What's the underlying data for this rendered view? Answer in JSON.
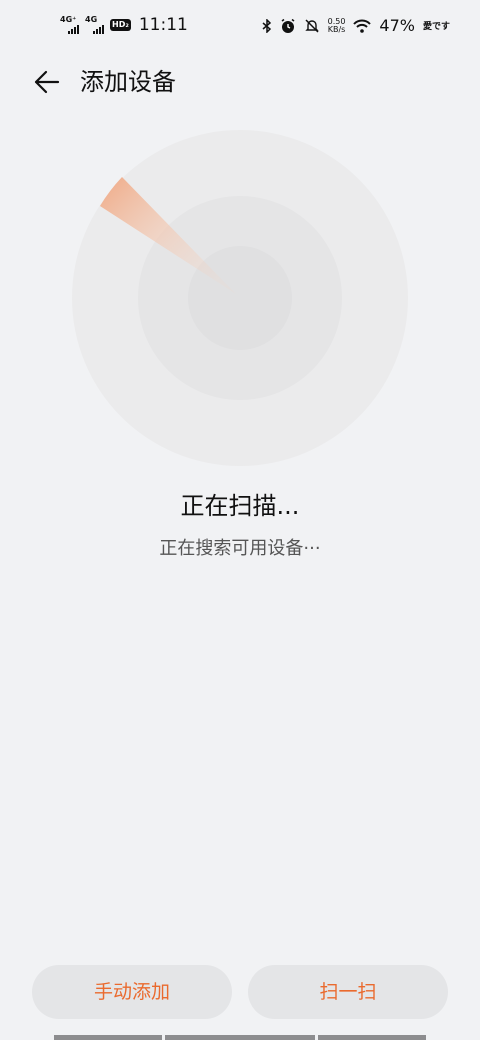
{
  "status_bar": {
    "network1": "4G⁺",
    "network2": "4G",
    "hd": "HD₂",
    "time": "11:11",
    "speed_value": "0.50",
    "speed_unit": "KB/s",
    "battery": "47%",
    "extra": "愛です",
    "icons": [
      "bluetooth-icon",
      "alarm-icon",
      "mute-icon",
      "wifi-icon"
    ]
  },
  "header": {
    "title": "添加设备",
    "back_icon": "arrow-left-icon"
  },
  "scan": {
    "title": "正在扫描...",
    "subtitle": "正在搜索可用设备···"
  },
  "actions": {
    "manual_add": "手动添加",
    "scan_code": "扫一扫"
  },
  "colors": {
    "background": "#f1f2f4",
    "accent": "#ea6a2e",
    "button_bg": "#e4e5e7"
  }
}
